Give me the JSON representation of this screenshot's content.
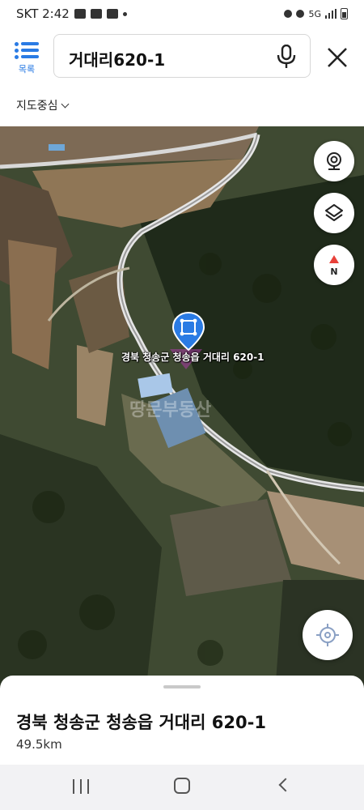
{
  "status_bar": {
    "carrier_time": "SKT 2:42",
    "network": "5G"
  },
  "header": {
    "list_label": "목록",
    "search_value": "거대리620-1",
    "map_center_label": "지도중심"
  },
  "map": {
    "pin_label": "경북 청송군 청송읍 거대리 620-1",
    "watermark": "땅문부동산",
    "icons": [
      "street-view-icon",
      "layers-icon",
      "compass-north-icon",
      "current-location-icon"
    ],
    "compass_letter": "N",
    "accent_color": "#2a7be4"
  },
  "result": {
    "address": "경북 청송군 청송읍 거대리 620-1",
    "distance": "49.5km"
  }
}
